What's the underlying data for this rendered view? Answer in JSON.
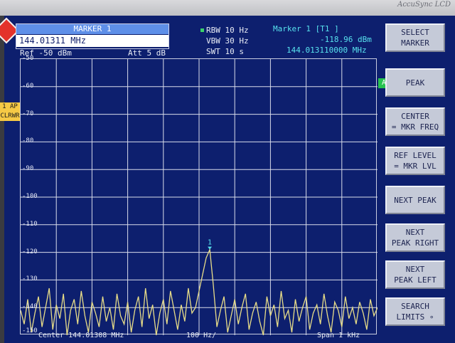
{
  "monitor": {
    "brand": "AccuSync LCD"
  },
  "marker_box": {
    "title": "MARKER 1",
    "input_value": "144.01311 MHz"
  },
  "header": {
    "ref_level": "Ref -50 dBm",
    "attenuation": "Att  5 dB",
    "rbw": "RBW 10 Hz",
    "vbw": "VBW 30 Hz",
    "swt": "SWT 10 s",
    "marker_label": "Marker 1 [T1 ]",
    "marker_level": "-118.96 dBm",
    "marker_freq": "144.013110000 MHz"
  },
  "indicators": {
    "trace_line1": "1 AP",
    "trace_line2": "CLRWR",
    "channel": "A"
  },
  "y_axis": {
    "labels": [
      "-50",
      "-60",
      "-70",
      "-80",
      "-90",
      "-100",
      "-110",
      "-120",
      "-130",
      "-140",
      "-150"
    ]
  },
  "footer": {
    "center": "Center 144.01308 MHz",
    "span_div": "100 Hz/",
    "span": "Span 1 kHz"
  },
  "marker_flag": "1",
  "softkeys": [
    "SELECT\nMARKER",
    "PEAK",
    "CENTER\n= MKR FREQ",
    "REF LEVEL\n= MKR  LVL",
    "NEXT PEAK",
    "NEXT\nPEAK RIGHT",
    "NEXT\nPEAK LEFT",
    "SEARCH\nLIMITS ∘"
  ],
  "colors": {
    "screen_bg": "#0d1f6e",
    "grid": "#d9dcea",
    "trace": "#e8dd88",
    "marker": "#58e2ee",
    "softkey_bg": "#c5cad8"
  },
  "chart_data": {
    "type": "line",
    "x_unit": "Hz offset from center",
    "xlim": [
      -500,
      500
    ],
    "ylim": [
      -150,
      -50
    ],
    "grid": true,
    "marker": {
      "x": 30,
      "y": -118.96
    },
    "series": [
      {
        "x": [
          -500,
          -490,
          -480,
          -470,
          -460,
          -450,
          -440,
          -430,
          -420,
          -410,
          -400,
          -390,
          -380,
          -370,
          -360,
          -350,
          -340,
          -330,
          -320,
          -310,
          -300,
          -290,
          -280,
          -270,
          -260,
          -250,
          -240,
          -230,
          -220,
          -210,
          -200,
          -190,
          -180,
          -170,
          -160,
          -150,
          -140,
          -130,
          -120,
          -110,
          -100,
          -90,
          -80,
          -70,
          -60,
          -50,
          -40,
          -30,
          -20,
          -10,
          0,
          10,
          20,
          30,
          40,
          50,
          60,
          70,
          80,
          90,
          100,
          110,
          120,
          130,
          140,
          150,
          160,
          170,
          180,
          190,
          200,
          210,
          220,
          230,
          240,
          250,
          260,
          270,
          280,
          290,
          300,
          310,
          320,
          330,
          340,
          350,
          360,
          370,
          380,
          390,
          400,
          410,
          420,
          430,
          440,
          450,
          460,
          470,
          480,
          490,
          500
        ],
        "values": [
          -141,
          -146,
          -137,
          -149,
          -142,
          -136,
          -147,
          -140,
          -133,
          -148,
          -139,
          -144,
          -135,
          -150,
          -141,
          -137,
          -146,
          -134,
          -143,
          -149,
          -138,
          -142,
          -147,
          -136,
          -145,
          -140,
          -148,
          -135,
          -143,
          -146,
          -138,
          -149,
          -141,
          -136,
          -147,
          -133,
          -144,
          -139,
          -150,
          -142,
          -137,
          -146,
          -134,
          -141,
          -148,
          -139,
          -145,
          -133,
          -142,
          -140,
          -134,
          -128,
          -122,
          -119,
          -132,
          -147,
          -141,
          -136,
          -149,
          -143,
          -137,
          -146,
          -140,
          -135,
          -148,
          -142,
          -138,
          -145,
          -150,
          -136,
          -143,
          -139,
          -147,
          -134,
          -144,
          -141,
          -149,
          -137,
          -145,
          -140,
          -136,
          -148,
          -142,
          -139,
          -146,
          -135,
          -143,
          -149,
          -138,
          -141,
          -147,
          -136,
          -144,
          -140,
          -146,
          -138,
          -142,
          -148,
          -137,
          -143,
          -140
        ]
      }
    ]
  }
}
